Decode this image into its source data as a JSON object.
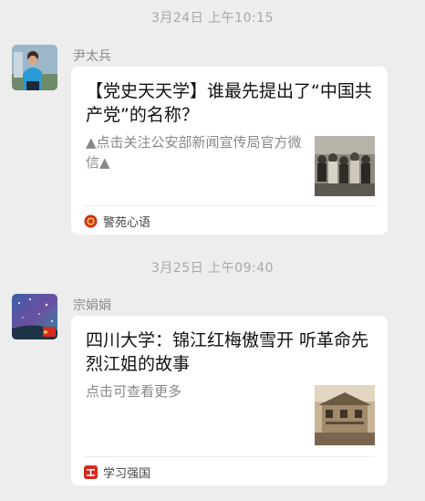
{
  "messages": [
    {
      "timestamp": "3月24日 上午10:15",
      "sender": "尹太兵",
      "card": {
        "title": "【党史天天学】谁最先提出了“中国共产党”的名称？",
        "description": "▲点击关注公安部新闻宣传局官方微信▲",
        "source": "警苑心语",
        "source_icon": "police-badge-icon",
        "thumbnail": "historic-group-photo"
      }
    },
    {
      "timestamp": "3月25日 上午09:40",
      "sender": "宗娟娟",
      "card": {
        "title": "四川大学：锦江红梅傲雪开 听革命先烈江姐的故事",
        "description": "点击可查看更多",
        "source": "学习强国",
        "source_icon": "xuexi-qiangguo-icon",
        "thumbnail": "historic-building-photo"
      }
    }
  ],
  "colors": {
    "background": "#ededed",
    "card": "#ffffff",
    "timestamp": "#a8a8a8",
    "sender": "#8c8c8c",
    "accent_red": "#d42a20"
  }
}
